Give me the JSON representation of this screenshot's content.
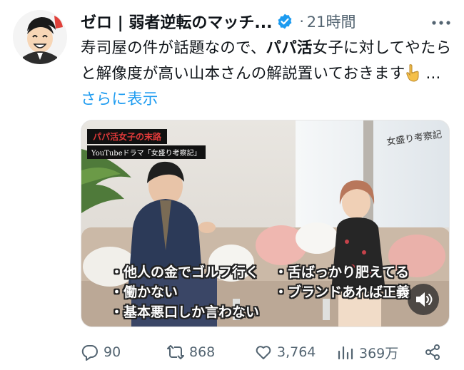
{
  "tweet": {
    "display_name": "ゼロ | 弱者逆転のマッチ...",
    "time_separator": "·",
    "time": "21時間",
    "body_part1": "寿司屋の件が話題なので、",
    "body_bold": "パパ活",
    "body_part2": "女子に対してやたらと解像度が高い山本さんの解説置いておきます",
    "ellipsis": " ...",
    "show_more": "さらに表示"
  },
  "media": {
    "caption_title": "パパ活女子の末路",
    "caption_sub": "YouTubeドラマ「女盛り考察記」",
    "logo_text": "女盛り考察記",
    "subtitles": [
      "・他人の金でゴルフ行く",
      "・舌ばっかり肥えてる",
      "・働かない",
      "・ブランドあれば正義",
      "・基本悪口しか言わない"
    ]
  },
  "actions": {
    "replies": "90",
    "retweets": "868",
    "likes": "3,764",
    "views": "369万"
  },
  "colors": {
    "accent": "#1d9bf0",
    "secondary_text": "#536471",
    "primary_text": "#0f1419"
  }
}
